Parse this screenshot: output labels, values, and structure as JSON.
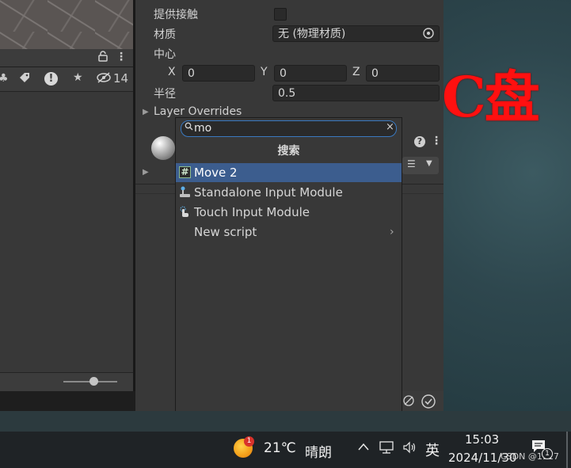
{
  "wallpaper": {
    "text": "C盘"
  },
  "hierarchy": {
    "visible_count": "14"
  },
  "inspector": {
    "provide_contact_label": "提供接触",
    "material_label": "材质",
    "material_value": "无 (物理材质)",
    "center_label": "中心",
    "center": {
      "x_label": "X",
      "x_value": "0",
      "y_label": "Y",
      "y_value": "0",
      "z_label": "Z",
      "z_value": "0"
    },
    "radius_label": "半径",
    "radius_value": "0.5",
    "layer_overrides_label": "Layer Overrides"
  },
  "add_component_popup": {
    "search_value": "mo",
    "header": "搜索",
    "items": [
      {
        "label": "Move 2",
        "icon": "csharp-script-icon",
        "selected": true
      },
      {
        "label": "Standalone Input Module",
        "icon": "input-module-icon",
        "selected": false
      },
      {
        "label": "Touch Input Module",
        "icon": "touch-module-icon",
        "selected": false
      },
      {
        "label": "New script",
        "icon": "",
        "selected": false,
        "has_submenu": true
      }
    ]
  },
  "taskbar": {
    "weather_badge": "1",
    "temperature": "21℃",
    "weather": "晴朗",
    "ime": "英",
    "time": "15:03",
    "date": "2024/11/30",
    "watermark": "CSDN @1917",
    "notification_count": "1"
  },
  "colors": {
    "accent": "#3c5d8e",
    "search_focus": "#3a79c0",
    "wallpaper_text": "#ff1010"
  }
}
